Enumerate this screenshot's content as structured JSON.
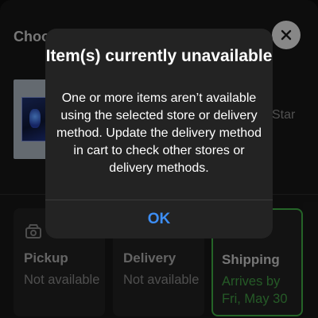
{
  "sheet": {
    "title": "Choo",
    "close_icon": "close-icon",
    "product_partial_text": "Star"
  },
  "options": [
    {
      "label": "Pickup",
      "status": "Not available",
      "icon": "store-icon"
    },
    {
      "label": "Delivery",
      "status": "Not available",
      "icon": "truck-icon"
    },
    {
      "label": "Shipping",
      "status": "Arrives by Fri, May 30",
      "icon": "",
      "selected": true
    }
  ],
  "alert": {
    "title": "Item(s) currently unavailable",
    "message": "One or more items aren’t available using the selected store or delivery method. Update the delivery method in cart to check other stores or delivery methods.",
    "ok_label": "OK"
  },
  "colors": {
    "accent_blue": "#3d8ef5",
    "selected_green": "#3a9a3e"
  }
}
